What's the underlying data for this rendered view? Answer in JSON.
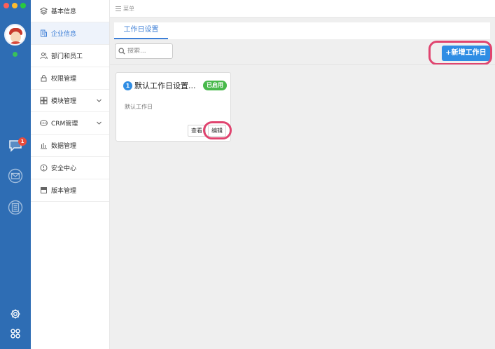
{
  "rail": {
    "message_badge": "1",
    "icons": [
      "avatar",
      "message-icon",
      "mail-icon",
      "document-icon",
      "settings-icon",
      "apps-icon"
    ]
  },
  "sidebar": {
    "items": [
      {
        "label": "基本信息",
        "icon": "layers-icon",
        "active": false
      },
      {
        "label": "企业信息",
        "icon": "building-icon",
        "active": true
      },
      {
        "label": "部门和员工",
        "icon": "users-icon",
        "active": false
      },
      {
        "label": "权限管理",
        "icon": "lock-icon",
        "active": false
      },
      {
        "label": "模块管理",
        "icon": "grid-icon",
        "active": false,
        "expandable": true
      },
      {
        "label": "CRM管理",
        "icon": "crm-icon",
        "active": false,
        "expandable": true
      },
      {
        "label": "数据管理",
        "icon": "bar-chart-icon",
        "active": false
      },
      {
        "label": "安全中心",
        "icon": "alert-circle-icon",
        "active": false
      },
      {
        "label": "版本管理",
        "icon": "window-icon",
        "active": false
      }
    ]
  },
  "header": {
    "menu_label": "菜单"
  },
  "main": {
    "tabs": [
      {
        "label": "工作日设置",
        "active": true
      }
    ],
    "search": {
      "placeholder": "搜索...",
      "value": ""
    },
    "add_button": "+新增工作日",
    "cards": [
      {
        "index": "1",
        "title": "默认工作日设置...",
        "status": "已启用",
        "description": "默认工作日",
        "view_label": "查看",
        "edit_label": "编辑"
      }
    ]
  },
  "colors": {
    "rail": "#2e6db4",
    "accent": "#2f8de4",
    "status_enabled": "#48b94b",
    "highlight_ring": "#e0446f",
    "badge": "#e84c3d"
  }
}
